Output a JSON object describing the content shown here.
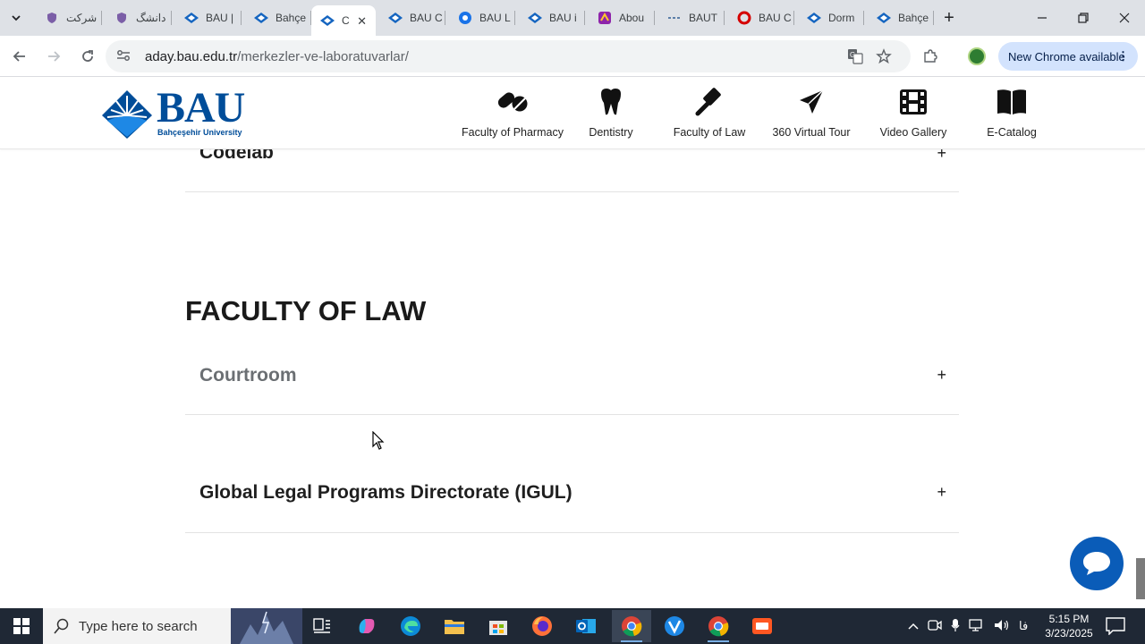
{
  "browser": {
    "tabs": [
      {
        "title": "شرکت",
        "icon": "purple-shield-icon",
        "active": false
      },
      {
        "title": "دانشگ",
        "icon": "purple-shield-icon",
        "active": false
      },
      {
        "title": "BAU |",
        "icon": "bau-logo-icon",
        "active": false
      },
      {
        "title": "Bahçe",
        "icon": "bau-logo-icon",
        "active": false
      },
      {
        "title": "C",
        "icon": "bau-logo-icon",
        "active": true
      },
      {
        "title": "BAU C",
        "icon": "bau-logo-icon",
        "active": false
      },
      {
        "title": "BAU L",
        "icon": "blue-circle-icon",
        "active": false
      },
      {
        "title": "BAU i",
        "icon": "bau-logo-icon",
        "active": false
      },
      {
        "title": "Abou",
        "icon": "gradient-app-icon",
        "active": false
      },
      {
        "title": "BAUT",
        "icon": "dash-logo-icon",
        "active": false
      },
      {
        "title": "BAU C",
        "icon": "red-ring-icon",
        "active": false
      },
      {
        "title": "Dorm",
        "icon": "bau-logo-icon",
        "active": false
      },
      {
        "title": "Bahçe",
        "icon": "bau-logo-icon",
        "active": false
      }
    ],
    "url_host": "aday.bau.edu.tr",
    "url_path": "/merkezler-ve-laboratuvarlar/",
    "update_button": "New Chrome available"
  },
  "site": {
    "logo_text": "BAU",
    "logo_subtext": "Bahçeşehir University",
    "nav": [
      {
        "label": "Faculty of Pharmacy",
        "icon": "pills-icon"
      },
      {
        "label": "Dentistry",
        "icon": "tooth-icon"
      },
      {
        "label": "Faculty of Law",
        "icon": "gavel-icon"
      },
      {
        "label": "360 Virtual Tour",
        "icon": "paper-plane-icon"
      },
      {
        "label": "Video Gallery",
        "icon": "film-icon"
      },
      {
        "label": "E-Catalog",
        "icon": "book-icon"
      }
    ]
  },
  "content": {
    "previous_item": "Codelab",
    "section_title": "FACULTY OF LAW",
    "items": [
      {
        "label": "Courtroom"
      },
      {
        "label": "Global Legal Programs Directorate (IGUL)"
      }
    ],
    "expand_symbol": "+"
  },
  "taskbar": {
    "search_placeholder": "Type here to search",
    "lang": "فا",
    "time": "5:15 PM",
    "date": "3/23/2025"
  },
  "colors": {
    "brand_blue": "#004d99",
    "chat_blue": "#0a5cb8",
    "taskbar": "#1f2835"
  }
}
